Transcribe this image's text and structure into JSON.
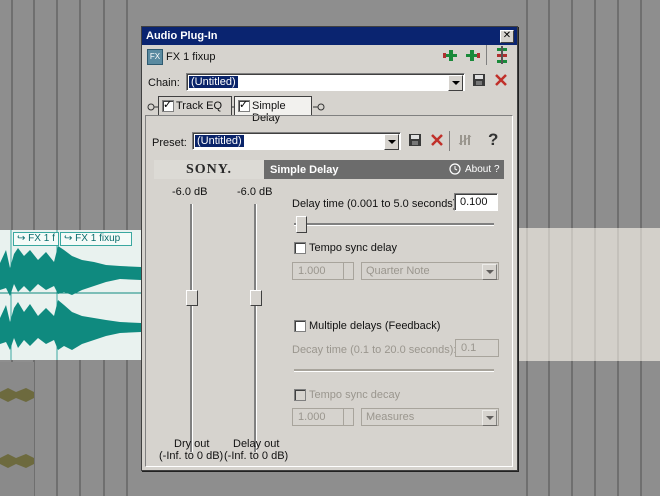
{
  "dialog": {
    "title": "Audio Plug-In",
    "fx_name": "FX 1 fixup",
    "chain_label": "Chain:",
    "chain_value": "(Untitled)",
    "plugins": [
      "Track EQ",
      "Simple Delay"
    ]
  },
  "preset": {
    "label": "Preset:",
    "value": "(Untitled)"
  },
  "header": {
    "brand": "SONY.",
    "plugin_name": "Simple Delay",
    "about": "About",
    "help": "?"
  },
  "faders": {
    "dry": {
      "db": "-6.0 dB",
      "label": "Dry out",
      "range": "(-Inf. to 0 dB)"
    },
    "delay": {
      "db": "-6.0 dB",
      "label": "Delay out",
      "range": "(-Inf. to 0 dB)"
    }
  },
  "params": {
    "delay_time_label": "Delay time (0.001 to 5.0 seconds):",
    "delay_time_value": "0.100",
    "tempo_sync_delay": "Tempo sync delay",
    "tempo_value": "1.000",
    "tempo_note": "Quarter Note",
    "multiple_delays": "Multiple delays (Feedback)",
    "decay_time_label": "Decay time (0.1 to 20.0 seconds):",
    "decay_time_value": "0.1",
    "tempo_sync_decay": "Tempo sync decay",
    "decay_tempo_value": "1.000",
    "decay_measures": "Measures"
  },
  "clips": [
    "FX 1 f",
    "FX 1 fixup"
  ],
  "colors": {
    "waveform": "#0f8a7f",
    "titlebar": "#0a246a",
    "delete": "#c0302a"
  }
}
